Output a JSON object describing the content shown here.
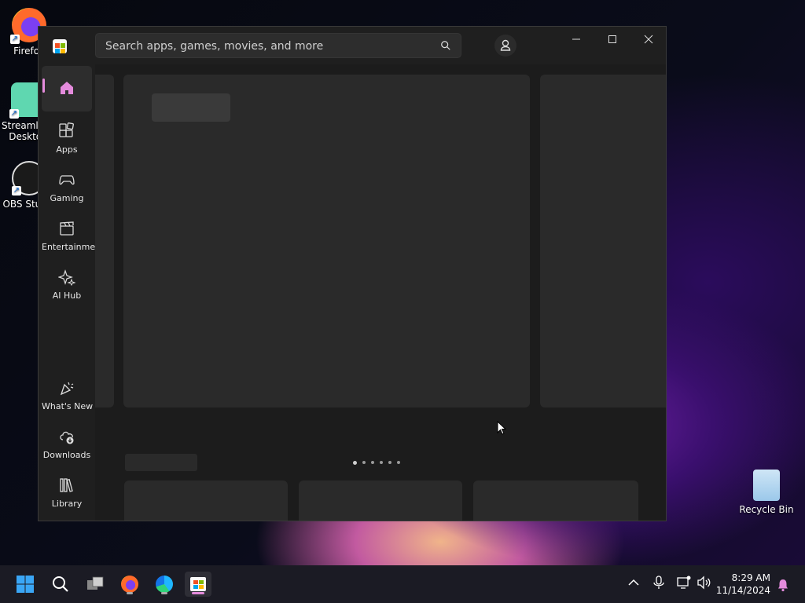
{
  "desktop": {
    "icons": [
      {
        "label": "Firefox"
      },
      {
        "label": "Streamlabs Desktop"
      },
      {
        "label": "OBS Studio"
      },
      {
        "label": "Recycle Bin"
      }
    ]
  },
  "window": {
    "search": {
      "placeholder": "Search apps, games, movies, and more"
    },
    "controls": {
      "minimize": "—",
      "maximize": "☐",
      "close": "✕"
    }
  },
  "sidebar": {
    "items": [
      {
        "label": "",
        "icon": "home-icon"
      },
      {
        "label": "Apps",
        "icon": "apps-icon"
      },
      {
        "label": "Gaming",
        "icon": "gamepad-icon"
      },
      {
        "label": "Entertainment",
        "icon": "clapperboard-icon"
      },
      {
        "label": "AI Hub",
        "icon": "sparkle-icon"
      },
      {
        "label": "What's New",
        "icon": "party-icon"
      },
      {
        "label": "Downloads",
        "icon": "download-cloud-icon"
      },
      {
        "label": "Library",
        "icon": "library-icon"
      }
    ]
  },
  "carousel": {
    "dot_count": 6,
    "active_index": 0
  },
  "taskbar": {
    "time": "8:29 AM",
    "date": "11/14/2024"
  },
  "colors": {
    "accent": "#e48bdc",
    "window_bg": "#1f1f1f",
    "skeleton": "#2a2a2a"
  }
}
